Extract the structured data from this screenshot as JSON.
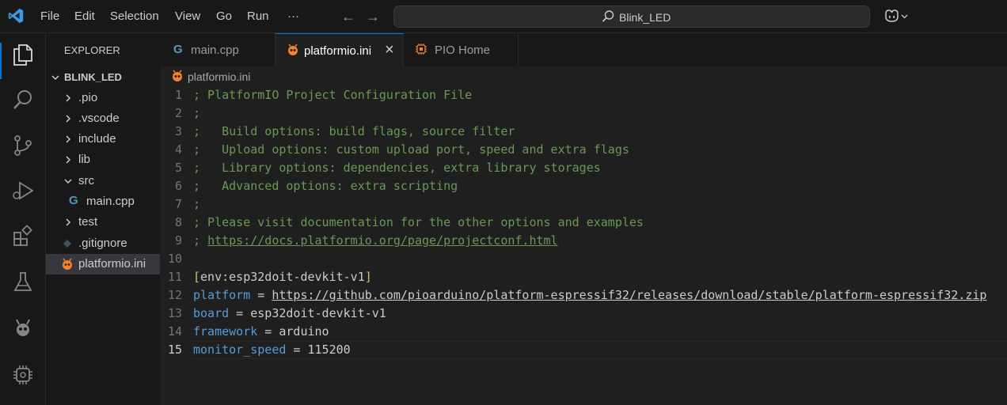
{
  "menu": [
    "File",
    "Edit",
    "Selection",
    "View",
    "Go",
    "Run",
    "···"
  ],
  "command_center": {
    "text": "Blink_LED"
  },
  "sidebar": {
    "title": "EXPLORER",
    "project": "BLINK_LED",
    "items": [
      {
        "label": ".pio"
      },
      {
        "label": ".vscode"
      },
      {
        "label": "include"
      },
      {
        "label": "lib"
      },
      {
        "label": "src"
      },
      {
        "label": "main.cpp"
      },
      {
        "label": "test"
      },
      {
        "label": ".gitignore"
      },
      {
        "label": "platformio.ini"
      }
    ]
  },
  "tabs": [
    {
      "label": "main.cpp"
    },
    {
      "label": "platformio.ini",
      "close": "×"
    },
    {
      "label": "PIO Home"
    }
  ],
  "breadcrumb": "platformio.ini",
  "code": {
    "line_numbers": [
      "1",
      "2",
      "3",
      "4",
      "5",
      "6",
      "7",
      "8",
      "9",
      "10",
      "11",
      "12",
      "13",
      "14",
      "15"
    ],
    "l1": "; PlatformIO Project Configuration File",
    "l2": ";",
    "l3": ";   Build options: build flags, source filter",
    "l4": ";   Upload options: custom upload port, speed and extra flags",
    "l5": ";   Library options: dependencies, extra library storages",
    "l6": ";   Advanced options: extra scripting",
    "l7": ";",
    "l8": "; Please visit documentation for the other options and examples",
    "l9_prefix": "; ",
    "l9_link": "https://docs.platformio.org/page/projectconf.html",
    "l11_open": "[",
    "l11_env": "env:esp32doit-devkit-v1",
    "l11_close": "]",
    "l12_key": "platform",
    "l12_eq": " = ",
    "l12_val": "https://github.com/pioarduino/platform-espressif32/releases/download/stable/platform-espressif32.zip",
    "l13_key": "board",
    "l13_eq": " = ",
    "l13_val": "esp32doit-devkit-v1",
    "l14_key": "framework",
    "l14_eq": " = ",
    "l14_val": "arduino",
    "l15_key": "monitor_speed",
    "l15_eq": " = ",
    "l15_val": "115200"
  },
  "colors": {
    "accent": "#0078d4",
    "comment": "#6a9955",
    "key": "#569cd6",
    "section": "#d7ba7d",
    "pio": "#f5822a"
  }
}
